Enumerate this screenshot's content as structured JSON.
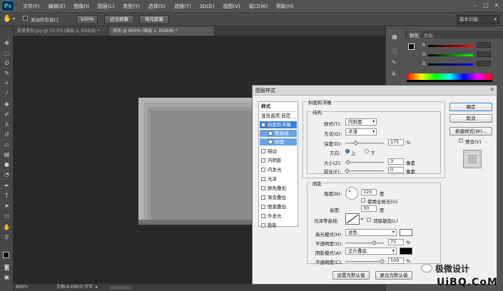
{
  "app": {
    "logo": "Ps"
  },
  "menu": [
    "文件(F)",
    "编辑(E)",
    "图像(I)",
    "图层(L)",
    "类型(Y)",
    "选择(S)",
    "滤镜(T)",
    "3D(D)",
    "视图(V)",
    "窗口(W)",
    "帮助(H)"
  ],
  "options": {
    "scroll_all": "滚动所有窗口",
    "zoom_100": "100%",
    "fit_screen": "适合屏幕",
    "fill_screen": "填充屏幕",
    "workspace": "基本功能"
  },
  "tabs": [
    "背景素材.jpg @ 33.3% (图层 1, RGB/8) *",
    "块状 @ 800% (图层 1, RGB/8) *"
  ],
  "status": {
    "zoom": "800%",
    "doc": "文档:4.69K/0 字节"
  },
  "panels": {
    "color_tab": "颜色",
    "swatch_tab": "色板",
    "r": "R",
    "g": "G",
    "b": "B"
  },
  "dialog": {
    "title": "图层样式",
    "styles_label": "样式",
    "blend_options": "混合选项:自定",
    "effects": [
      {
        "label": "斜面和浮雕",
        "checked": true,
        "selected": true
      },
      {
        "label": "等高线",
        "checked": false,
        "sub": true
      },
      {
        "label": "纹理",
        "checked": false,
        "sub": true
      },
      {
        "label": "描边",
        "checked": false
      },
      {
        "label": "内阴影",
        "checked": false
      },
      {
        "label": "内发光",
        "checked": false
      },
      {
        "label": "光泽",
        "checked": false
      },
      {
        "label": "颜色叠加",
        "checked": false
      },
      {
        "label": "渐变叠加",
        "checked": false
      },
      {
        "label": "图案叠加",
        "checked": false
      },
      {
        "label": "外发光",
        "checked": false
      },
      {
        "label": "投影",
        "checked": false
      }
    ],
    "section_title": "斜面和浮雕",
    "structure": "结构",
    "style_label": "样式(T):",
    "style_value": "内斜面",
    "technique_label": "方法(Q):",
    "technique_value": "平滑",
    "depth_label": "深度(D):",
    "depth_value": "175",
    "depth_unit": "%",
    "direction_label": "方向:",
    "dir_up": "上",
    "dir_down": "下",
    "size_label": "大小(Z):",
    "size_value": "3",
    "size_unit": "像素",
    "soften_label": "软化(F):",
    "soften_value": "0",
    "soften_unit": "像素",
    "shading": "阴影",
    "angle_label": "角度(N):",
    "angle_value": "120",
    "angle_unit": "度",
    "global_light": "使用全局光(G)",
    "altitude_label": "高度:",
    "altitude_value": "30",
    "altitude_unit": "度",
    "gloss_label": "光泽等高线:",
    "anti_alias": "消除锯齿(L)",
    "highlight_label": "高光模式(H):",
    "highlight_value": "滤色",
    "opacity1_label": "不透明度(O):",
    "opacity1_value": "75",
    "opacity_unit": "%",
    "shadow_label": "阴影模式(A):",
    "shadow_value": "正片叠底",
    "opacity2_label": "不透明度(C):",
    "opacity2_value": "100",
    "btn_default": "设置为默认值",
    "btn_reset": "复位为默认值",
    "btn_ok": "确定",
    "btn_cancel": "取消",
    "btn_new_style": "新建样式(W)...",
    "preview": "预览(V)"
  },
  "watermark": {
    "brand": "极微设计",
    "site": "UiBQ.CoM"
  },
  "colors": {
    "highlight": "#ffffff",
    "shadow": "#000000",
    "accent": "#3a7fd5"
  }
}
